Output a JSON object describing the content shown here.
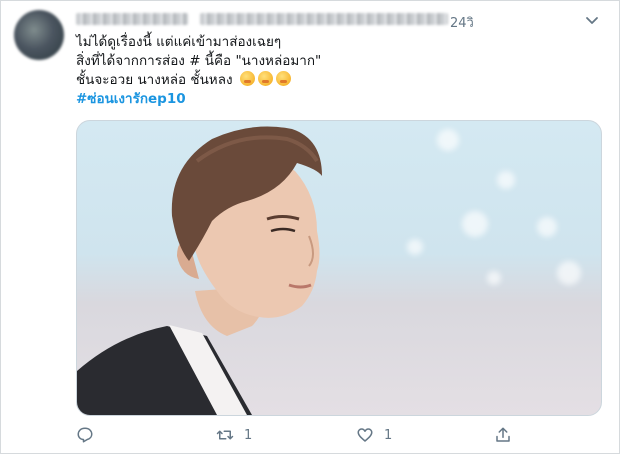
{
  "tweet": {
    "time": "24วิ",
    "text_lines": [
      "ไม่ได้ดูเรื่องนี้ แต่แค่เข้ามาส่องเฉยๆ",
      "สิ่งที่ได้จากการส่อง # นี้คือ \"นางหล่อมาก\"",
      "ชั้นจะอวย นางหล่อ ชั้นหลง"
    ],
    "hashtag": "#ซ่อนเงารักep10",
    "emoji_count": 3
  },
  "actions": {
    "reply_count": "",
    "retweet_count": "1",
    "like_count": "1"
  },
  "icons": {
    "reply": "reply-icon",
    "retweet": "retweet-icon",
    "like": "heart-icon",
    "share": "share-icon",
    "menu": "chevron-down-icon"
  },
  "colors": {
    "accent": "#1b95e0",
    "muted": "#657786",
    "text": "#14171a"
  }
}
